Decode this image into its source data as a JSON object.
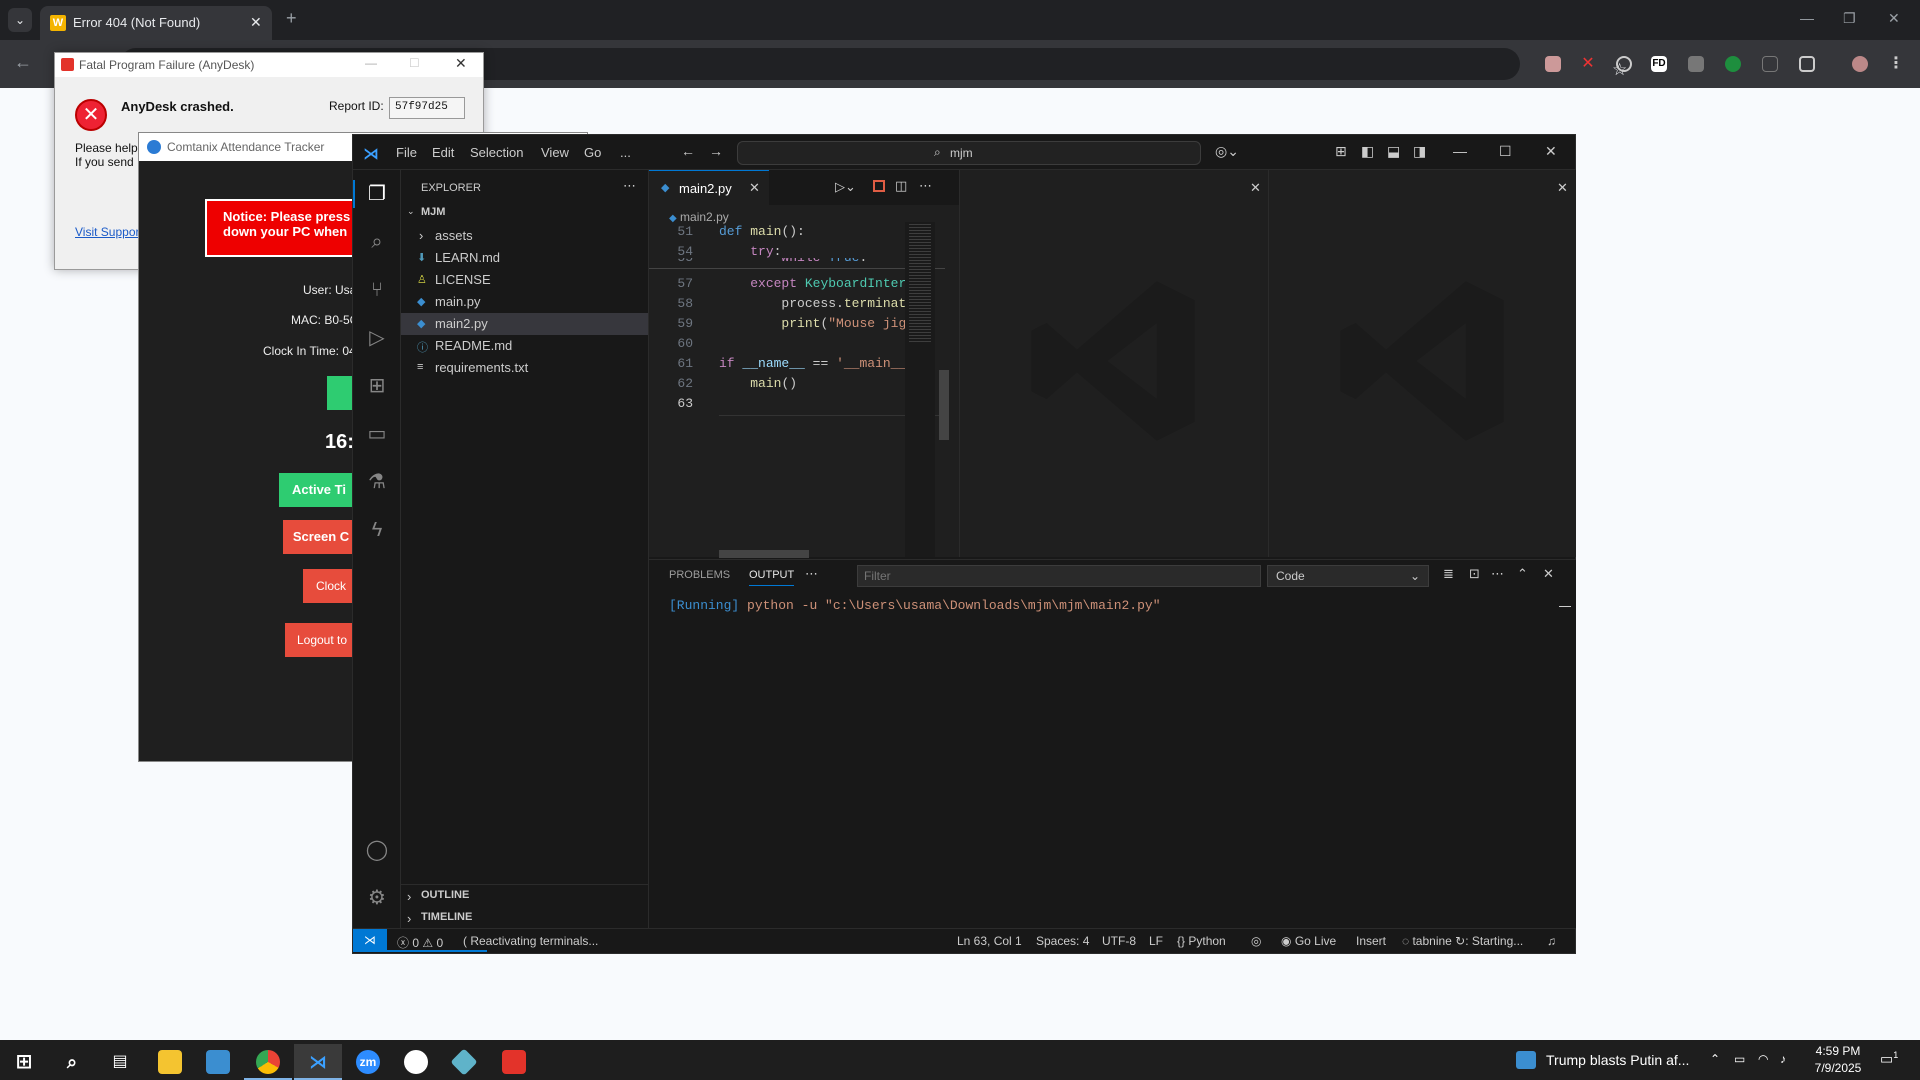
{
  "browser": {
    "tab_list_icon": "chevron-down-icon",
    "tab_title": "Error 404 (Not Found)",
    "favicon_letter": "W",
    "extension_fd": "FD"
  },
  "anydesk_dialog": {
    "title": "Fatal Program Failure (AnyDesk)",
    "heading": "AnyDesk crashed.",
    "report_label": "Report ID:",
    "report_id": "57f97d25",
    "text_line1": "Please help",
    "text_line2": "If you send",
    "link": "Visit Suppor"
  },
  "tracker": {
    "title": "Comtanix Attendance Tracker",
    "notice_line1": "Notice: Please press",
    "notice_line2": "down your PC when",
    "user": "User: Usa",
    "mac": "MAC: B0-5C",
    "clock_in": "Clock In Time: 04",
    "timer": "16:",
    "btn_active": "Active Ti",
    "btn_screen": "Screen C",
    "btn_clock": "Clock",
    "btn_logout": "Logout to"
  },
  "vscode": {
    "menu": [
      "File",
      "Edit",
      "Selection",
      "View",
      "Go",
      "..."
    ],
    "search": "mjm",
    "explorer_title": "EXPLORER",
    "workspace": "MJM",
    "files": [
      {
        "name": "assets",
        "type": "folder"
      },
      {
        "name": "LEARN.md",
        "type": "md"
      },
      {
        "name": "LICENSE",
        "type": "license"
      },
      {
        "name": "main.py",
        "type": "py"
      },
      {
        "name": "main2.py",
        "type": "py"
      },
      {
        "name": "README.md",
        "type": "info"
      },
      {
        "name": "requirements.txt",
        "type": "txt"
      }
    ],
    "outline": "OUTLINE",
    "timeline": "TIMELINE",
    "active_tab": "main2.py",
    "breadcrumb": "main2.py",
    "code_lines": [
      {
        "n": "51",
        "text": "def main():"
      },
      {
        "n": "54",
        "text": "    try:"
      },
      {
        "n": "55",
        "text": "        while True:"
      },
      {
        "n": "57",
        "text": "    except KeyboardInterr"
      },
      {
        "n": "58",
        "text": "        process.terminate"
      },
      {
        "n": "59",
        "text": "        print(\"Mouse jigg"
      },
      {
        "n": "60",
        "text": ""
      },
      {
        "n": "61",
        "text": "if __name__ == '__main__'"
      },
      {
        "n": "62",
        "text": "    main()"
      },
      {
        "n": "63",
        "text": ""
      }
    ],
    "panel_tabs": {
      "problems": "PROBLEMS",
      "output": "OUTPUT"
    },
    "filter_placeholder": "Filter",
    "output_channel": "Code",
    "output_running": "[Running]",
    "output_cmd": "python -u \"c:\\Users\\usama\\Downloads\\mjm\\mjm\\main2.py\"",
    "status": {
      "errors": "0",
      "warnings": "0",
      "message": "Reactivating terminals...",
      "position": "Ln 63, Col 1",
      "spaces": "Spaces: 4",
      "encoding": "UTF-8",
      "eol": "LF",
      "language": "Python",
      "go_live": "Go Live",
      "insert": "Insert",
      "tabnine": "tabnine",
      "starting": "Starting..."
    }
  },
  "taskbar": {
    "news": "Trump blasts Putin af...",
    "time": "4:59 PM",
    "date": "7/9/2025",
    "notif_count": "1",
    "zoom_label": "zm"
  }
}
